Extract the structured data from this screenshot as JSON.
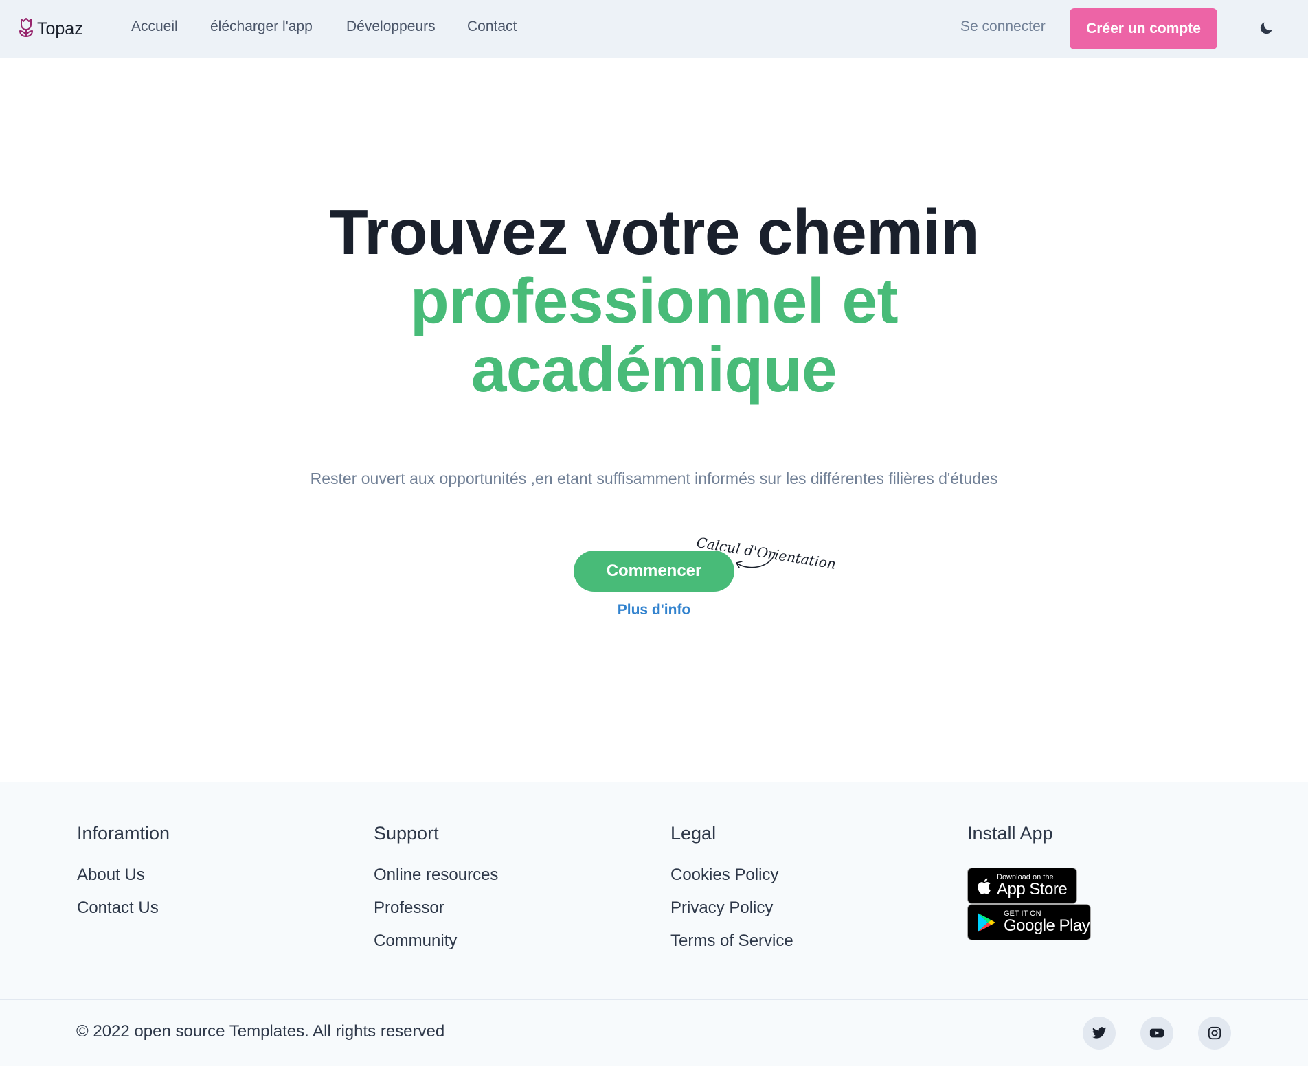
{
  "nav": {
    "brand": "Topaz",
    "links": [
      "Accueil",
      "élécharger l'app",
      "Développeurs",
      "Contact"
    ],
    "signin": "Se connecter",
    "signup": "Créer un compte",
    "theme_icon": "moon-icon"
  },
  "hero": {
    "title_line1": "Trouvez votre chemin",
    "title_line2": "professionnel et",
    "title_line3": "académique",
    "subtitle": "Rester ouvert aux opportunités ,en etant suffisamment informés sur les différentes filières d'études",
    "cta": "Commencer",
    "more_info": "Plus d'info",
    "annotation": "Calcul d'Orientation"
  },
  "footer": {
    "columns": [
      {
        "heading": "Inforamtion",
        "links": [
          "About Us",
          "Contact Us"
        ]
      },
      {
        "heading": "Support",
        "links": [
          "Online resources",
          "Professor",
          "Community"
        ]
      },
      {
        "heading": "Legal",
        "links": [
          "Cookies Policy",
          "Privacy Policy",
          "Terms of Service"
        ]
      },
      {
        "heading": "Install App",
        "links": []
      }
    ],
    "app_store": {
      "small": "Download on the",
      "big": "App Store"
    },
    "google_play": {
      "small": "GET IT ON",
      "big": "Google Play"
    },
    "copyright": "© 2022 open source Templates. All rights reserved",
    "social": [
      "twitter-icon",
      "youtube-icon",
      "instagram-icon"
    ]
  },
  "colors": {
    "brand_pink": "#ed64a6",
    "accent_green": "#48bb78",
    "link_blue": "#3182ce",
    "nav_bg": "#edf2f7",
    "footer_bg": "#f7fafc",
    "logo_purple": "#97266d"
  }
}
